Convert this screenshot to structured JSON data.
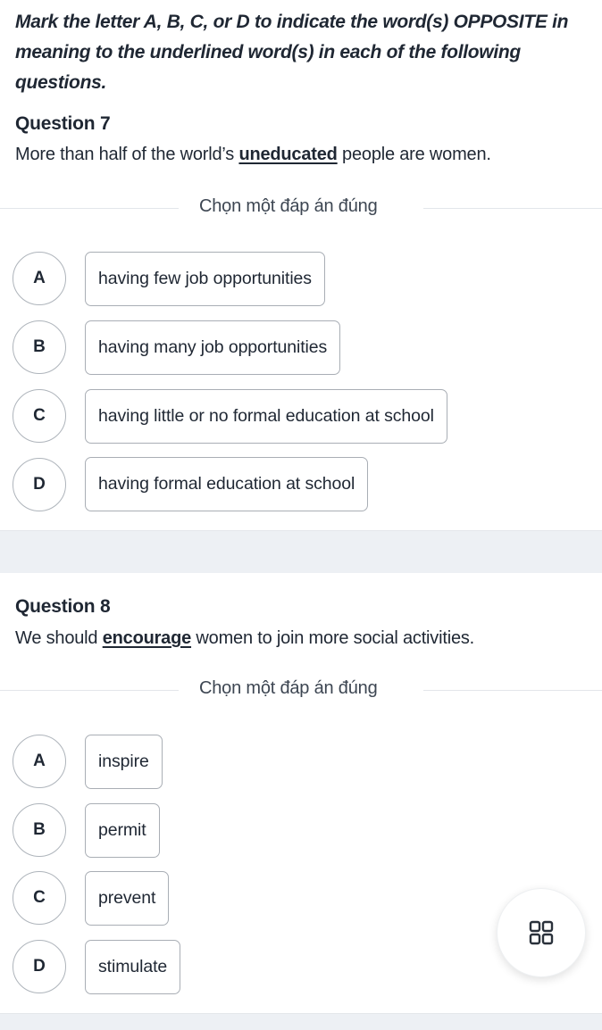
{
  "instructions": "Mark the letter A, B, C, or D to indicate the word(s) OPPOSITE in meaning to the underlined word(s) in each of the following questions.",
  "questions": [
    {
      "title": "Question 7",
      "sentence_before": "More than half of the world’s ",
      "underlined": "uneducated",
      "sentence_after": " people are women.",
      "choose_label": "Chọn một đáp án đúng",
      "options": [
        {
          "letter": "A",
          "text": "having few job opportunities"
        },
        {
          "letter": "B",
          "text": "having many job opportunities"
        },
        {
          "letter": "C",
          "text": "having little or no formal education at school"
        },
        {
          "letter": "D",
          "text": "having formal education at school"
        }
      ]
    },
    {
      "title": "Question 8",
      "sentence_before": "We should ",
      "underlined": "encourage",
      "sentence_after": " women to join more social activities.",
      "choose_label": "Chọn một đáp án đúng",
      "options": [
        {
          "letter": "A",
          "text": "inspire"
        },
        {
          "letter": "B",
          "text": "permit"
        },
        {
          "letter": "C",
          "text": "prevent"
        },
        {
          "letter": "D",
          "text": "stimulate"
        }
      ]
    }
  ],
  "floating_button": {
    "icon": "grid-icon"
  }
}
